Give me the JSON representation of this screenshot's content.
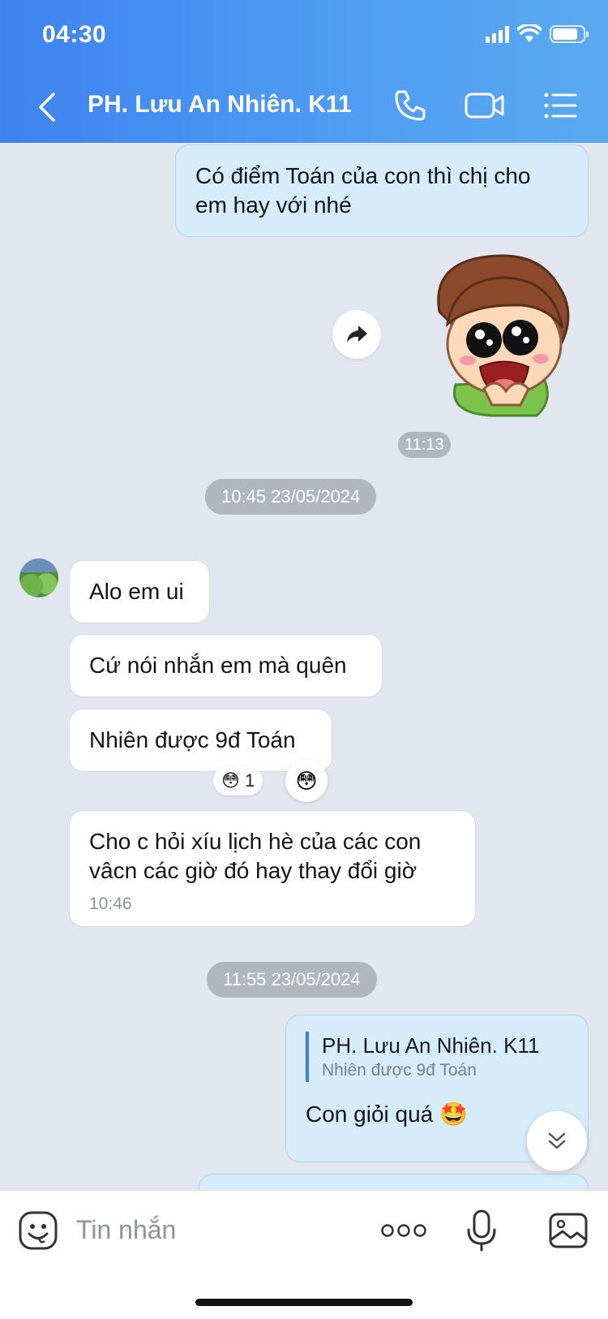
{
  "status_bar": {
    "time": "04:30"
  },
  "header": {
    "title": "PH. Lưu An Nhiên. K11"
  },
  "messages": {
    "out_1": "Có điểm Toán của con thì chị cho em hay với nhé",
    "sticker_time": "11:13",
    "date_1": "10:45 23/05/2024",
    "in_1": "Alo em ui",
    "in_2": "Cứ nói nhắn em mà quên",
    "in_3": "Nhiên được 9đ Toán",
    "in_3_reaction_count": "1",
    "in_4": "Cho c hỏi xíu lịch hè của các con vâcn các giờ đó hay thay đổi giờ",
    "in_4_time": "10:46",
    "date_2": "11:55 23/05/2024",
    "reply_quote_name": "PH. Lưu An Nhiên. K11",
    "reply_quote_text": "Nhiên được 9đ Toán",
    "reply_text": "Con giỏi quá 🤩"
  },
  "input": {
    "placeholder": "Tin nhắn"
  },
  "colors": {
    "header_start": "#3d83f0",
    "header_end": "#5aa9ef",
    "out_bubble": "#d6ecfb",
    "chat_bg": "#e2e6ee"
  },
  "icons": [
    "chevron-left-icon",
    "phone-icon",
    "video-icon",
    "list-icon",
    "forward-icon",
    "emoji-icon",
    "more-icon",
    "mic-icon",
    "image-icon",
    "chevron-double-down-icon"
  ]
}
